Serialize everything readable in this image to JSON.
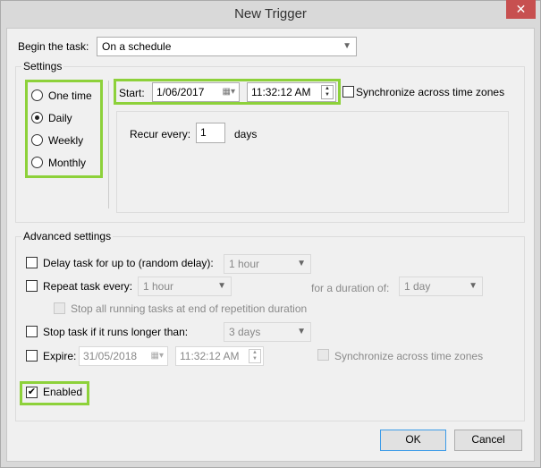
{
  "window": {
    "title": "New Trigger",
    "close_glyph": "✕"
  },
  "begin": {
    "label": "Begin the task:",
    "value": "On a schedule"
  },
  "settings": {
    "label": "Settings",
    "schedule_options": [
      {
        "label": "One time",
        "selected": false
      },
      {
        "label": "Daily",
        "selected": true
      },
      {
        "label": "Weekly",
        "selected": false
      },
      {
        "label": "Monthly",
        "selected": false
      }
    ],
    "start_label": "Start:",
    "start_date": "1/06/2017",
    "start_time": "11:32:12 AM",
    "sync_label": "Synchronize across time zones",
    "sync_checked": false,
    "recur_label": "Recur every:",
    "recur_value": "1",
    "recur_unit": "days"
  },
  "advanced": {
    "label": "Advanced settings",
    "delay": {
      "label": "Delay task for up to (random delay):",
      "value": "1 hour",
      "checked": false
    },
    "repeat": {
      "label": "Repeat task every:",
      "value": "1 hour",
      "duration_label": "for a duration of:",
      "duration_value": "1 day",
      "checked": false
    },
    "stop_all": {
      "label": "Stop all running tasks at end of repetition duration"
    },
    "stop_longer": {
      "label": "Stop task if it runs longer than:",
      "value": "3 days",
      "checked": false
    },
    "expire": {
      "label": "Expire:",
      "date": "31/05/2018",
      "time": "11:32:12 AM",
      "sync_label": "Synchronize across time zones"
    },
    "enabled": {
      "label": "Enabled",
      "checked": true
    }
  },
  "buttons": {
    "ok": "OK",
    "cancel": "Cancel"
  }
}
